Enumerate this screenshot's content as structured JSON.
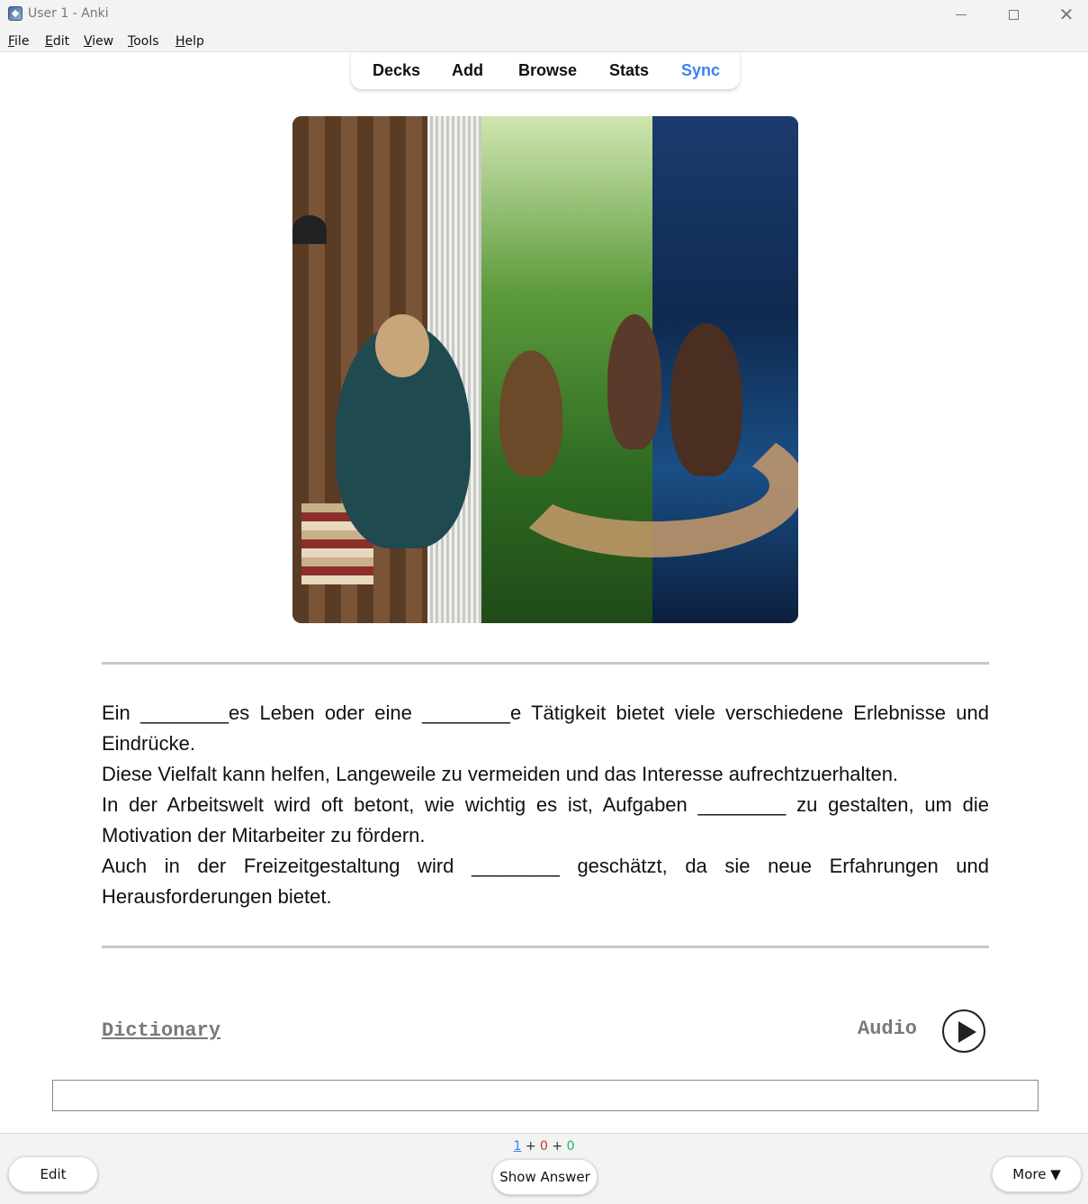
{
  "window": {
    "title": "User 1 - Anki",
    "controls": {
      "minimize": "",
      "maximize": "",
      "close": "✕"
    }
  },
  "menu": {
    "items": [
      "File",
      "Edit",
      "View",
      "Tools",
      "Help"
    ]
  },
  "toolbar": {
    "items": [
      "Decks",
      "Add",
      "Browse",
      "Stats",
      "Sync"
    ],
    "accent_color": "#3b82f6"
  },
  "card": {
    "paragraphs": [
      "Ein ________es Leben oder eine ________e Tätigkeit bietet viele verschiedene Erlebnisse und Eindrücke.",
      "Diese Vielfalt kann helfen, Langeweile zu vermeiden und das Interesse aufrechtzuerhalten.",
      "In der Arbeitswelt wird oft betont, wie wichtig es ist, Aufgaben ________ zu gestalten, um die Motivation der Mitarbeiter zu fördern.",
      "Auch in der Freizeitgestaltung wird ________ geschätzt, da sie neue Erfahrungen und Herausforderungen bietet."
    ],
    "dictionary_label": "Dictionary",
    "audio_label": "Audio",
    "answer_value": ""
  },
  "bottom": {
    "counts": {
      "new": "1",
      "learn": "0",
      "review": "0",
      "sep": "+"
    },
    "edit_label": "Edit",
    "show_answer_label": "Show Answer",
    "more_label": "More ▼"
  }
}
